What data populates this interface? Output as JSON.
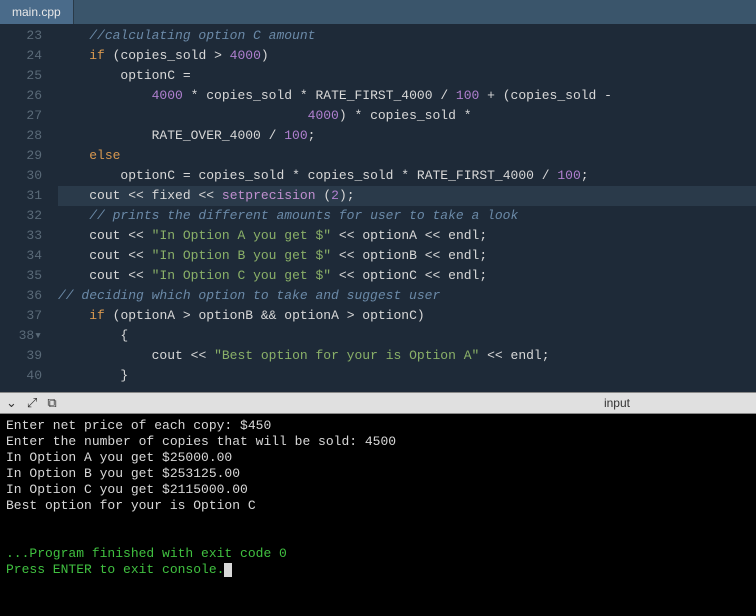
{
  "tab": {
    "filename": "main.cpp"
  },
  "gutter": {
    "start": 23,
    "end": 40,
    "fold_markers": [
      38
    ]
  },
  "code_lines": [
    {
      "n": 23,
      "indent": 1,
      "tokens": [
        [
          "c-comment",
          "//calculating option C amount"
        ]
      ]
    },
    {
      "n": 24,
      "indent": 1,
      "tokens": [
        [
          "c-kw",
          "if"
        ],
        [
          "c-op",
          " ("
        ],
        [
          "c-id",
          "copies_sold"
        ],
        [
          "c-op",
          " > "
        ],
        [
          "c-num",
          "4000"
        ],
        [
          "c-op",
          ")"
        ]
      ]
    },
    {
      "n": 25,
      "indent": 2,
      "tokens": [
        [
          "c-id",
          "optionC"
        ],
        [
          "c-op",
          " ="
        ]
      ]
    },
    {
      "n": 26,
      "indent": 3,
      "tokens": [
        [
          "c-num",
          "4000"
        ],
        [
          "c-op",
          " * "
        ],
        [
          "c-id",
          "copies_sold"
        ],
        [
          "c-op",
          " * "
        ],
        [
          "c-id",
          "RATE_FIRST_4000"
        ],
        [
          "c-op",
          " / "
        ],
        [
          "c-num",
          "100"
        ],
        [
          "c-op",
          " + ("
        ],
        [
          "c-id",
          "copies_sold"
        ],
        [
          "c-op",
          " -"
        ]
      ]
    },
    {
      "n": 27,
      "indent": 8,
      "tokens": [
        [
          "c-num",
          "4000"
        ],
        [
          "c-op",
          ") * "
        ],
        [
          "c-id",
          "copies_sold"
        ],
        [
          "c-op",
          " *"
        ]
      ]
    },
    {
      "n": 28,
      "indent": 3,
      "tokens": [
        [
          "c-id",
          "RATE_OVER_4000"
        ],
        [
          "c-op",
          " / "
        ],
        [
          "c-num",
          "100"
        ],
        [
          "c-op",
          ";"
        ]
      ]
    },
    {
      "n": 29,
      "indent": 1,
      "tokens": [
        [
          "c-kw",
          "else"
        ]
      ]
    },
    {
      "n": 30,
      "indent": 2,
      "tokens": [
        [
          "c-id",
          "optionC"
        ],
        [
          "c-op",
          " = "
        ],
        [
          "c-id",
          "copies_sold"
        ],
        [
          "c-op",
          " * "
        ],
        [
          "c-id",
          "copies_sold"
        ],
        [
          "c-op",
          " * "
        ],
        [
          "c-id",
          "RATE_FIRST_4000"
        ],
        [
          "c-op",
          " / "
        ],
        [
          "c-num",
          "100"
        ],
        [
          "c-op",
          ";"
        ]
      ]
    },
    {
      "n": 31,
      "indent": 1,
      "hl": true,
      "tokens": [
        [
          "c-id",
          "cout"
        ],
        [
          "c-op",
          " << "
        ],
        [
          "c-id",
          "fixed"
        ],
        [
          "c-op",
          " << "
        ],
        [
          "c-fn",
          "setprecision"
        ],
        [
          "c-op",
          " ("
        ],
        [
          "c-num",
          "2"
        ],
        [
          "c-op",
          ");"
        ]
      ]
    },
    {
      "n": 32,
      "indent": 1,
      "tokens": [
        [
          "c-comment",
          "// prints the different amounts for user to take a look"
        ]
      ]
    },
    {
      "n": 33,
      "indent": 1,
      "tokens": [
        [
          "c-id",
          "cout"
        ],
        [
          "c-op",
          " << "
        ],
        [
          "c-str",
          "\"In Option A you get $\""
        ],
        [
          "c-op",
          " << "
        ],
        [
          "c-id",
          "optionA"
        ],
        [
          "c-op",
          " << "
        ],
        [
          "c-id",
          "endl"
        ],
        [
          "c-op",
          ";"
        ]
      ]
    },
    {
      "n": 34,
      "indent": 1,
      "tokens": [
        [
          "c-id",
          "cout"
        ],
        [
          "c-op",
          " << "
        ],
        [
          "c-str",
          "\"In Option B you get $\""
        ],
        [
          "c-op",
          " << "
        ],
        [
          "c-id",
          "optionB"
        ],
        [
          "c-op",
          " << "
        ],
        [
          "c-id",
          "endl"
        ],
        [
          "c-op",
          ";"
        ]
      ]
    },
    {
      "n": 35,
      "indent": 1,
      "tokens": [
        [
          "c-id",
          "cout"
        ],
        [
          "c-op",
          " << "
        ],
        [
          "c-str",
          "\"In Option C you get $\""
        ],
        [
          "c-op",
          " << "
        ],
        [
          "c-id",
          "optionC"
        ],
        [
          "c-op",
          " << "
        ],
        [
          "c-id",
          "endl"
        ],
        [
          "c-op",
          ";"
        ]
      ]
    },
    {
      "n": 36,
      "indent": 0,
      "tokens": [
        [
          "c-comment",
          "// deciding which option to take and suggest user"
        ]
      ]
    },
    {
      "n": 37,
      "indent": 1,
      "tokens": [
        [
          "c-kw",
          "if"
        ],
        [
          "c-op",
          " ("
        ],
        [
          "c-id",
          "optionA"
        ],
        [
          "c-op",
          " > "
        ],
        [
          "c-id",
          "optionB"
        ],
        [
          "c-op",
          " && "
        ],
        [
          "c-id",
          "optionA"
        ],
        [
          "c-op",
          " > "
        ],
        [
          "c-id",
          "optionC"
        ],
        [
          "c-op",
          ")"
        ]
      ]
    },
    {
      "n": 38,
      "indent": 2,
      "tokens": [
        [
          "c-op",
          "{"
        ]
      ]
    },
    {
      "n": 39,
      "indent": 3,
      "tokens": [
        [
          "c-id",
          "cout"
        ],
        [
          "c-op",
          " << "
        ],
        [
          "c-str",
          "\"Best option for your is Option A\""
        ],
        [
          "c-op",
          " << "
        ],
        [
          "c-id",
          "endl"
        ],
        [
          "c-op",
          ";"
        ]
      ]
    },
    {
      "n": 40,
      "indent": 2,
      "tokens": [
        [
          "c-op",
          "}"
        ]
      ]
    }
  ],
  "toolbar": {
    "label": "input",
    "icons": [
      "chevron-down",
      "fullscreen",
      "copy"
    ]
  },
  "console": {
    "lines": [
      "Enter net price of each copy: $450",
      "Enter the number of copies that will be sold: 4500",
      "In Option A you get $25000.00",
      "In Option B you get $253125.00",
      "In Option C you get $2115000.00",
      "Best option for your is Option C",
      "",
      ""
    ],
    "finish_line": "...Program finished with exit code 0",
    "prompt": "Press ENTER to exit console."
  }
}
